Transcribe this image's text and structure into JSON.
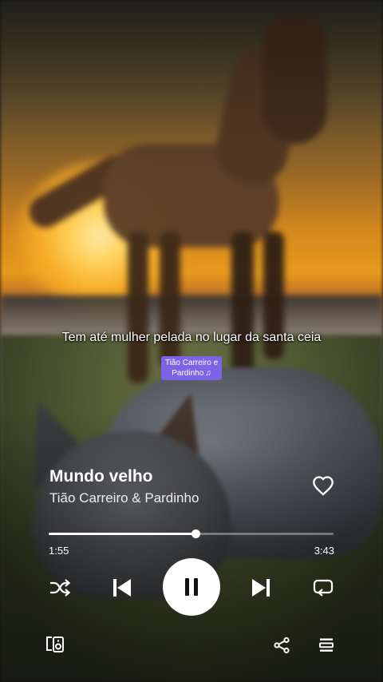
{
  "lyrics": {
    "current_line": "Tem até mulher pelada no lugar da santa ceia"
  },
  "artist_chip": {
    "text": "Tião Carreiro e Pardinho",
    "icon": "music-note-icon"
  },
  "track": {
    "title": "Mundo velho",
    "artist": "Tião Carreiro & Pardinho",
    "liked": false
  },
  "progress": {
    "elapsed": "1:55",
    "total": "3:43",
    "fraction": 0.516
  },
  "controls": {
    "shuffle_icon": "shuffle-icon",
    "prev_icon": "skip-previous-icon",
    "play_state": "playing",
    "next_icon": "skip-next-icon",
    "repeat_icon": "repeat-icon",
    "device_icon": "device-speaker-icon",
    "share_icon": "share-icon",
    "queue_icon": "queue-icon"
  },
  "colors": {
    "accent": "#7d63e6",
    "foreground": "#ffffff"
  }
}
